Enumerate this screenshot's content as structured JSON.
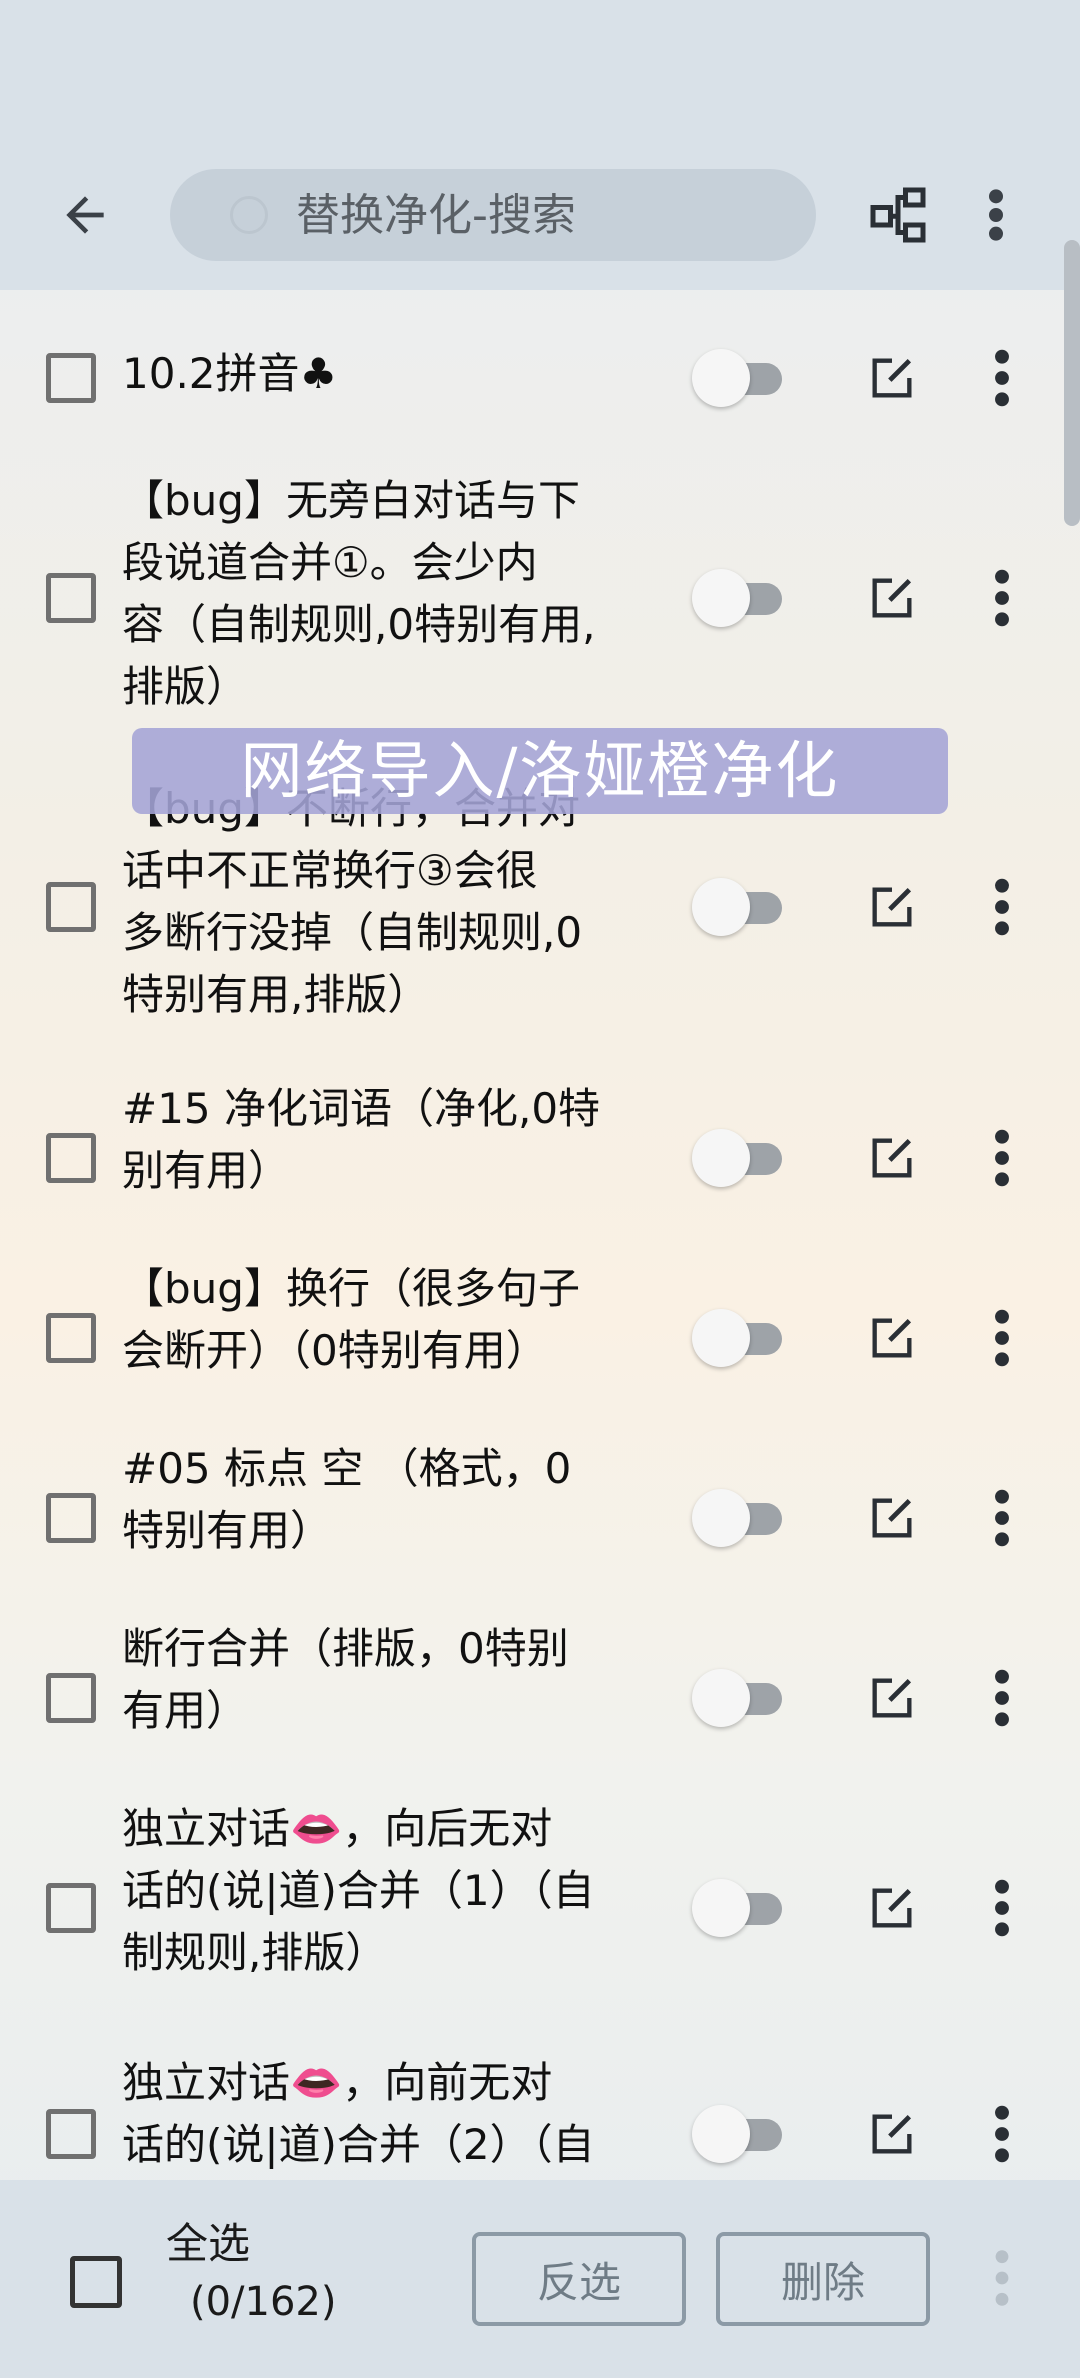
{
  "search": {
    "placeholder": "替换净化-搜索"
  },
  "rules": [
    {
      "label": "10.2拼音♣"
    },
    {
      "label": "【bug】无旁白对话与下\n段说道合并①。会少内\n容（自制规则,0特别有用,\n排版）"
    },
    {
      "label": "【bug】不断行，合并对\n话中不正常换行③会很\n多断行没掉（自制规则,0\n特别有用,排版）"
    },
    {
      "label": "#15 净化词语（净化,0特\n别有用）"
    },
    {
      "label": "【bug】换行（很多句子\n会断开）（0特别有用）"
    },
    {
      "label": "#05 标点 空 （格式，0\n特别有用）"
    },
    {
      "label": "断行合并（排版，0特别\n有用）"
    },
    {
      "label": "独立对话👄，向后无对\n话的(说|道)合并（1）（自\n制规则,排版）"
    },
    {
      "label": "独立对话👄，向前无对\n话的(说|道)合并（2）（自"
    }
  ],
  "watermark": "网络导入/洛娅橙净化",
  "footer": {
    "select_all": "全选",
    "count": "(0/162)",
    "invert": "反选",
    "delete": "删除"
  }
}
